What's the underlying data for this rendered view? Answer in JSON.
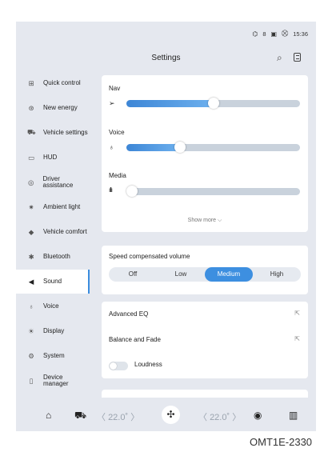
{
  "status_bar": {
    "signal": "8",
    "time": "15:36"
  },
  "header": {
    "title": "Settings"
  },
  "sidebar": {
    "items": [
      {
        "label": "Quick control",
        "icon": "quick-control-icon",
        "glyph": "⊞"
      },
      {
        "label": "New energy",
        "icon": "new-energy-icon",
        "glyph": "⊛"
      },
      {
        "label": "Vehicle settings",
        "icon": "car-icon",
        "glyph": "⛟"
      },
      {
        "label": "HUD",
        "icon": "hud-icon",
        "glyph": "▭"
      },
      {
        "label": "Driver assistance",
        "icon": "steering-wheel-icon",
        "glyph": "◎"
      },
      {
        "label": "Ambient light",
        "icon": "ambient-light-icon",
        "glyph": "✷"
      },
      {
        "label": "Vehicle comfort",
        "icon": "leaf-icon",
        "glyph": "◆"
      },
      {
        "label": "Bluetooth",
        "icon": "bluetooth-icon",
        "glyph": "✱"
      },
      {
        "label": "Sound",
        "icon": "speaker-icon",
        "glyph": "◀"
      },
      {
        "label": "Voice",
        "icon": "microphone-icon",
        "glyph": "♁"
      },
      {
        "label": "Display",
        "icon": "brightness-icon",
        "glyph": "☀"
      },
      {
        "label": "System",
        "icon": "gear-icon",
        "glyph": "⚙"
      },
      {
        "label": "Device manager",
        "icon": "device-icon",
        "glyph": "▯"
      }
    ],
    "active": "Sound"
  },
  "volume": {
    "nav": {
      "label": "Nav",
      "level": 0.5
    },
    "voice": {
      "label": "Voice",
      "level": 0.31
    },
    "media": {
      "label": "Media",
      "level": 0.0
    },
    "show_more": "Show more"
  },
  "speed_volume": {
    "label": "Speed compensated volume",
    "options": [
      "Off",
      "Low",
      "Medium",
      "High"
    ],
    "selected": "Medium"
  },
  "eq": {
    "advanced_eq": "Advanced EQ",
    "balance_fade": "Balance and Fade",
    "loudness": "Loudness",
    "loudness_on": false
  },
  "climate": {
    "left_temp": "22.0˚",
    "right_temp": "22.0˚"
  },
  "caption": "OMT1E-2330",
  "colors": {
    "accent": "#3d8fe0",
    "background": "#e5e8ef",
    "card": "#ffffff"
  }
}
